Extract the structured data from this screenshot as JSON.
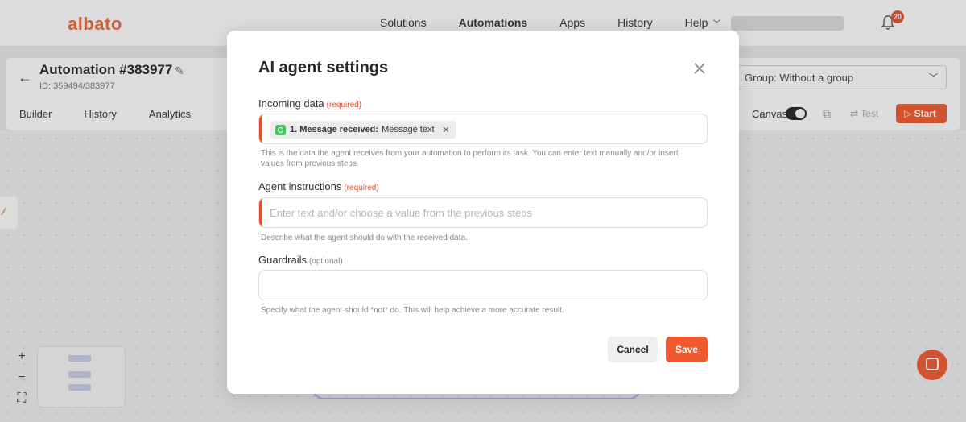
{
  "app": {
    "logo": "albato",
    "nav": [
      "Solutions",
      "Automations",
      "Apps",
      "History",
      "Help"
    ],
    "active_nav": "Automations",
    "notifications_count": "20"
  },
  "automation": {
    "title": "Automation #383977",
    "id_line": "ID: 359494/383977",
    "tabs": [
      "Builder",
      "History",
      "Analytics"
    ],
    "group_select": "Group: Without a group",
    "canvas_label": "Canvas",
    "test_label": "Test",
    "start_label": "Start"
  },
  "modal": {
    "title": "AI agent settings",
    "incoming": {
      "label": "Incoming data",
      "tag": "(required)",
      "chip_step": "1. Message received:",
      "chip_value": "Message text",
      "help": "This is the data the agent receives from your automation to perform its task. You can enter text manually and/or insert values from previous steps."
    },
    "instructions": {
      "label": "Agent instructions",
      "tag": "(required)",
      "placeholder": "Enter text and/or choose a value from the previous steps",
      "value": "",
      "help": "Describe what the agent should do with the received data."
    },
    "guardrails": {
      "label": "Guardrails",
      "tag": "(optional)",
      "value": "",
      "help": "Specify what the agent should *not* do. This will help achieve a more accurate result."
    },
    "cancel_label": "Cancel",
    "save_label": "Save"
  },
  "colors": {
    "accent": "#f0592d",
    "required_mark": "#e4502c",
    "whatsapp": "#43c45c"
  },
  "icons": [
    "back-arrow-icon",
    "pencil-icon",
    "bell-icon",
    "close-icon",
    "whatsapp-icon",
    "chip-remove-icon",
    "chat-icon"
  ]
}
